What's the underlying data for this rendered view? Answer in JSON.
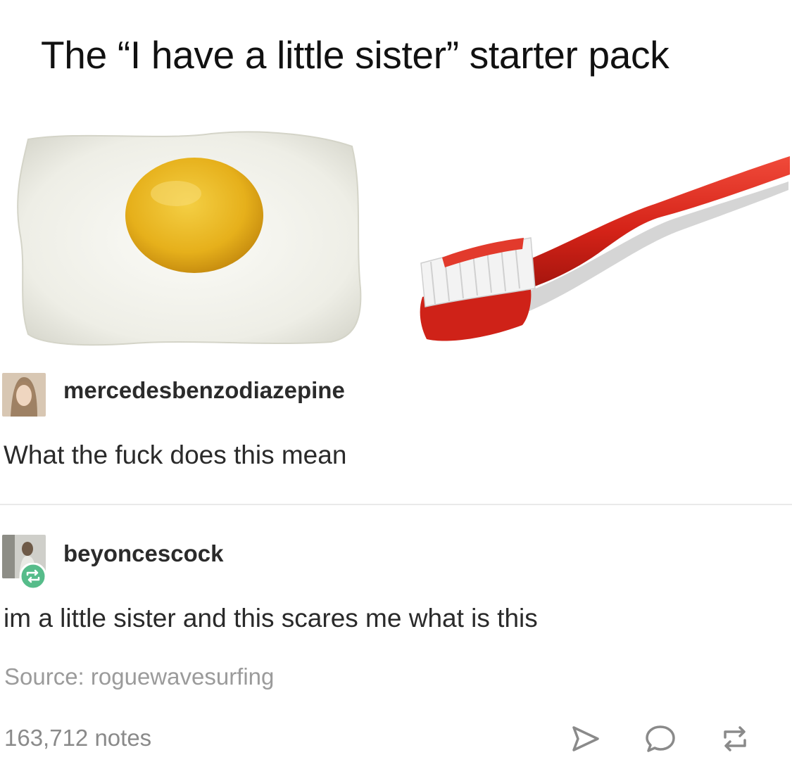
{
  "post": {
    "title": "The “I have a little sister” starter pack",
    "images": [
      {
        "icon": "fried-egg-image"
      },
      {
        "icon": "toothbrush-image"
      }
    ]
  },
  "replies": [
    {
      "username": "mercedesbenzodiazepine",
      "text": "What the fuck does this mean",
      "avatar_icon": "user-avatar"
    },
    {
      "username": "beyoncescock",
      "text": "im a little sister and this scares me what is this",
      "avatar_icon": "user-avatar",
      "badge_icon": "reblog-badge-icon"
    }
  ],
  "footer": {
    "source_label": "Source: roguewavesurfing",
    "notes_label": "163,712 notes",
    "actions": [
      "share-icon",
      "reply-icon",
      "reblog-icon"
    ]
  },
  "colors": {
    "text": "#222222",
    "muted": "#9b9b9b",
    "divider": "#e9e9e9",
    "reblog_green": "#56bc8a",
    "toothbrush_red": "#d8281f",
    "yolk": "#e9b51c"
  }
}
